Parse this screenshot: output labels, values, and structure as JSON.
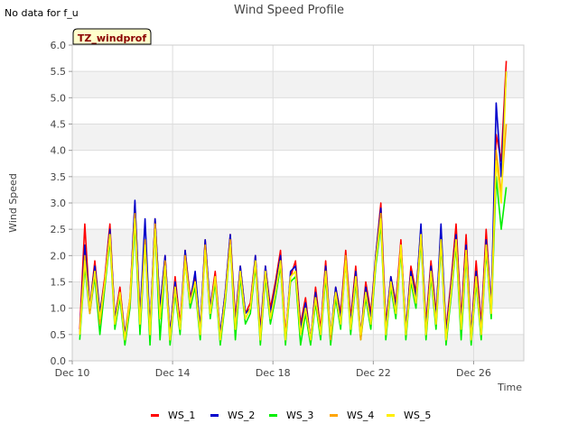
{
  "note": "No data for f_u",
  "badge": "TZ_windprof",
  "chart_data": {
    "type": "line",
    "title": "Wind Speed Profile",
    "xlabel": "Time",
    "ylabel": "Wind Speed",
    "x_start": "Dec 10",
    "x_end": "Dec 28",
    "x_range_days": [
      10,
      28
    ],
    "ylim": [
      0,
      6
    ],
    "xticks": [
      {
        "day": 10,
        "label": "Dec 10"
      },
      {
        "day": 14,
        "label": "Dec 14"
      },
      {
        "day": 18,
        "label": "Dec 18"
      },
      {
        "day": 22,
        "label": "Dec 22"
      },
      {
        "day": 26,
        "label": "Dec 26"
      }
    ],
    "yticks": [
      0,
      0.5,
      1,
      1.5,
      2,
      2.5,
      3,
      3.5,
      4,
      4.5,
      5,
      5.5,
      6
    ],
    "ytick_labels": [
      "0.0",
      "0.5",
      "1.0",
      "1.5",
      "2.0",
      "2.5",
      "3.0",
      "3.5",
      "4.0",
      "4.5",
      "5.0",
      "5.5",
      "6.0"
    ],
    "grid": true,
    "banded_background": true,
    "legend_position": "bottom",
    "x_days": [
      10.3,
      10.5,
      10.7,
      10.9,
      11.1,
      11.3,
      11.5,
      11.7,
      11.9,
      12.1,
      12.3,
      12.5,
      12.7,
      12.9,
      13.1,
      13.3,
      13.5,
      13.7,
      13.9,
      14.1,
      14.3,
      14.5,
      14.7,
      14.9,
      15.1,
      15.3,
      15.5,
      15.7,
      15.9,
      16.1,
      16.3,
      16.5,
      16.7,
      16.9,
      17.1,
      17.3,
      17.5,
      17.7,
      17.9,
      18.1,
      18.3,
      18.5,
      18.7,
      18.9,
      19.1,
      19.3,
      19.5,
      19.7,
      19.9,
      20.1,
      20.3,
      20.5,
      20.7,
      20.9,
      21.1,
      21.3,
      21.5,
      21.7,
      21.9,
      22.1,
      22.3,
      22.5,
      22.7,
      22.9,
      23.1,
      23.3,
      23.5,
      23.7,
      23.9,
      24.1,
      24.3,
      24.5,
      24.7,
      24.9,
      25.1,
      25.3,
      25.5,
      25.7,
      25.9,
      26.1,
      26.3,
      26.5,
      26.7,
      26.9,
      27.1,
      27.3
    ],
    "series": [
      {
        "name": "WS_1",
        "color": "#ff0000",
        "values": [
          0.6,
          2.6,
          1.0,
          1.9,
          0.9,
          1.6,
          2.6,
          0.8,
          1.4,
          0.5,
          1.2,
          3.0,
          0.9,
          2.3,
          0.6,
          2.7,
          1.0,
          2.0,
          0.5,
          1.6,
          0.7,
          2.1,
          1.2,
          1.6,
          0.6,
          2.3,
          1.0,
          1.7,
          0.5,
          1.3,
          2.4,
          0.8,
          1.8,
          0.9,
          1.1,
          2.0,
          0.6,
          1.8,
          1.0,
          1.5,
          2.1,
          0.5,
          1.6,
          1.9,
          0.7,
          1.2,
          0.4,
          1.4,
          0.6,
          1.9,
          0.5,
          1.4,
          0.9,
          2.1,
          0.8,
          1.8,
          0.5,
          1.5,
          0.9,
          2.0,
          3.0,
          0.7,
          1.6,
          1.1,
          2.3,
          0.6,
          1.8,
          1.3,
          2.5,
          0.7,
          1.9,
          0.9,
          2.4,
          0.6,
          1.5,
          2.6,
          0.8,
          2.4,
          0.5,
          1.9,
          0.7,
          2.5,
          1.0,
          4.3,
          3.8,
          5.7
        ]
      },
      {
        "name": "WS_2",
        "color": "#0000cc",
        "values": [
          0.5,
          2.2,
          1.0,
          1.8,
          0.9,
          1.5,
          2.5,
          0.8,
          1.3,
          0.5,
          1.1,
          3.05,
          0.8,
          2.7,
          0.6,
          2.7,
          1.0,
          2.0,
          0.5,
          1.5,
          0.6,
          2.1,
          1.1,
          1.7,
          0.6,
          2.3,
          1.0,
          1.6,
          0.5,
          1.3,
          2.4,
          0.7,
          1.8,
          0.9,
          1.0,
          2.0,
          0.5,
          1.8,
          0.9,
          1.4,
          2.0,
          0.4,
          1.7,
          1.8,
          0.6,
          1.1,
          0.4,
          1.3,
          0.5,
          1.8,
          0.5,
          1.4,
          0.8,
          2.0,
          0.7,
          1.7,
          0.5,
          1.4,
          0.8,
          2.0,
          2.9,
          0.6,
          1.6,
          1.0,
          2.2,
          0.6,
          1.7,
          1.2,
          2.6,
          0.6,
          1.8,
          0.8,
          2.6,
          0.5,
          1.4,
          2.4,
          0.7,
          2.2,
          0.5,
          1.7,
          0.6,
          2.3,
          1.0,
          4.9,
          3.5,
          5.5
        ]
      },
      {
        "name": "WS_3",
        "color": "#00ee00",
        "values": [
          0.4,
          1.8,
          0.9,
          1.6,
          0.5,
          1.4,
          2.3,
          0.6,
          1.2,
          0.3,
          1.0,
          2.6,
          0.5,
          2.2,
          0.3,
          2.5,
          0.4,
          1.8,
          0.3,
          1.3,
          0.5,
          1.9,
          1.0,
          1.4,
          0.4,
          2.1,
          0.8,
          1.5,
          0.3,
          1.1,
          2.2,
          0.4,
          1.6,
          0.7,
          0.9,
          1.8,
          0.3,
          1.6,
          0.7,
          1.2,
          1.8,
          0.3,
          1.5,
          1.6,
          0.3,
          0.9,
          0.3,
          1.1,
          0.4,
          1.6,
          0.3,
          1.2,
          0.6,
          1.9,
          0.5,
          1.5,
          0.4,
          1.2,
          0.6,
          1.8,
          2.6,
          0.4,
          1.4,
          0.8,
          2.1,
          0.4,
          1.5,
          1.0,
          2.3,
          0.4,
          1.6,
          0.6,
          2.2,
          0.3,
          1.2,
          2.2,
          0.4,
          2.0,
          0.3,
          1.5,
          0.4,
          2.1,
          0.8,
          3.5,
          2.5,
          3.3
        ]
      },
      {
        "name": "WS_4",
        "color": "#ffa500",
        "values": [
          0.5,
          2.0,
          0.9,
          1.7,
          0.7,
          1.5,
          2.4,
          0.7,
          1.3,
          0.4,
          1.1,
          2.8,
          0.7,
          2.3,
          0.5,
          2.6,
          0.8,
          1.9,
          0.4,
          1.4,
          0.6,
          2.0,
          1.1,
          1.5,
          0.5,
          2.2,
          0.9,
          1.6,
          0.4,
          1.2,
          2.3,
          0.6,
          1.7,
          0.8,
          1.0,
          1.9,
          0.4,
          1.7,
          0.8,
          1.3,
          1.9,
          0.4,
          1.6,
          1.7,
          0.5,
          1.0,
          0.4,
          1.2,
          0.5,
          1.7,
          0.4,
          1.3,
          0.7,
          2.0,
          0.6,
          1.6,
          0.4,
          1.3,
          0.7,
          1.9,
          2.8,
          0.5,
          1.5,
          0.9,
          2.2,
          0.5,
          1.6,
          1.1,
          2.4,
          0.5,
          1.7,
          0.7,
          2.3,
          0.4,
          1.3,
          2.3,
          0.6,
          2.1,
          0.4,
          1.6,
          0.5,
          2.2,
          0.9,
          4.0,
          3.2,
          4.5
        ]
      },
      {
        "name": "WS_5",
        "color": "#ffee00",
        "values": [
          0.5,
          1.9,
          1.0,
          1.7,
          0.8,
          1.5,
          2.4,
          0.7,
          1.3,
          0.4,
          1.2,
          2.7,
          0.7,
          2.2,
          0.5,
          2.5,
          0.8,
          1.8,
          0.4,
          1.4,
          0.6,
          1.9,
          1.1,
          1.5,
          0.5,
          2.1,
          0.9,
          1.6,
          0.4,
          1.2,
          2.2,
          0.6,
          1.7,
          0.8,
          1.0,
          1.9,
          0.4,
          1.7,
          0.8,
          1.3,
          1.9,
          0.4,
          1.6,
          1.7,
          0.5,
          1.0,
          0.4,
          1.2,
          0.5,
          1.7,
          0.5,
          1.3,
          0.7,
          1.9,
          0.6,
          1.6,
          0.5,
          1.3,
          0.7,
          1.9,
          2.7,
          0.5,
          1.5,
          0.9,
          2.2,
          0.5,
          1.6,
          1.1,
          2.4,
          0.5,
          1.7,
          0.7,
          2.3,
          0.4,
          1.3,
          2.3,
          0.6,
          2.1,
          0.4,
          1.6,
          0.5,
          2.2,
          0.9,
          3.8,
          3.0,
          5.5
        ]
      }
    ]
  }
}
